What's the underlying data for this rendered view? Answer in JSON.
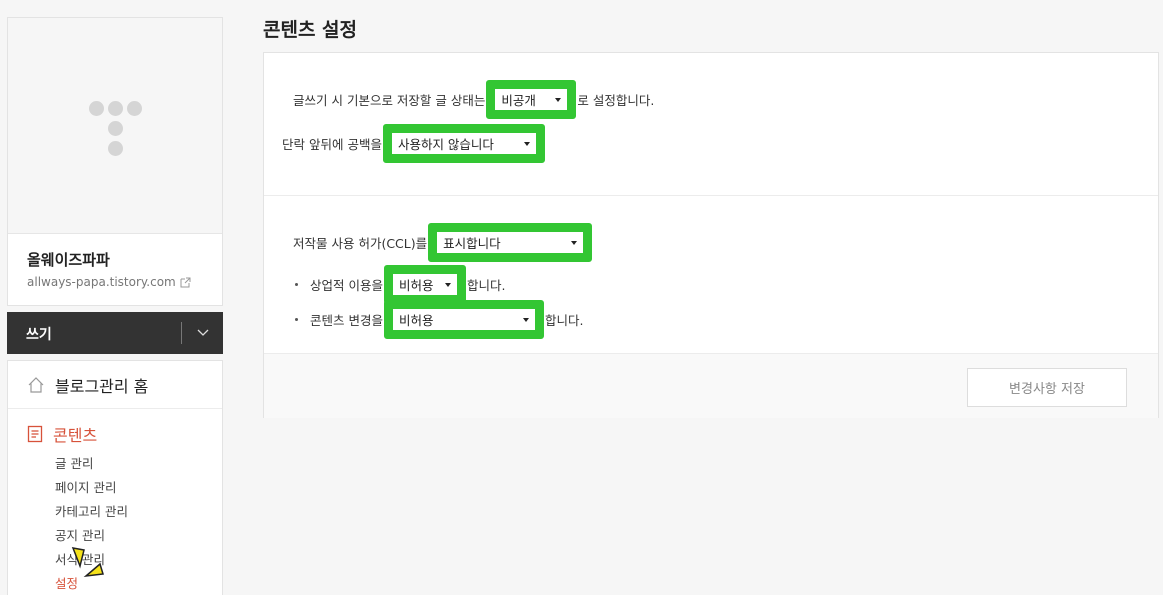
{
  "sidebar": {
    "blog_name": "올웨이즈파파",
    "blog_url": "allways-papa.tistory.com",
    "write_label": "쓰기",
    "home_label": "블로그관리 홈",
    "section_label": "콘텐츠",
    "submenu": [
      "글 관리",
      "페이지 관리",
      "카테고리 관리",
      "공지 관리",
      "서식 관리",
      "설정"
    ],
    "active_color": "#d7523a"
  },
  "main": {
    "title": "콘텐츠 설정",
    "default_status": {
      "prefix": "글쓰기 시 기본으로 저장할 글 상태는",
      "value": "비공개",
      "suffix": "로 설정합니다."
    },
    "paragraph_space": {
      "prefix": "단락 앞뒤에 공백을",
      "value": "사용하지 않습니다"
    },
    "ccl": {
      "prefix": "저작물 사용 허가(CCL)를",
      "value": "표시합니다"
    },
    "commercial": {
      "prefix": "상업적 이용을",
      "value": "비허용",
      "suffix": "합니다."
    },
    "modification": {
      "prefix": "콘텐츠 변경을",
      "value": "비허용",
      "suffix": "합니다."
    },
    "save_label": "변경사항 저장",
    "highlight_color": "#33c633"
  }
}
